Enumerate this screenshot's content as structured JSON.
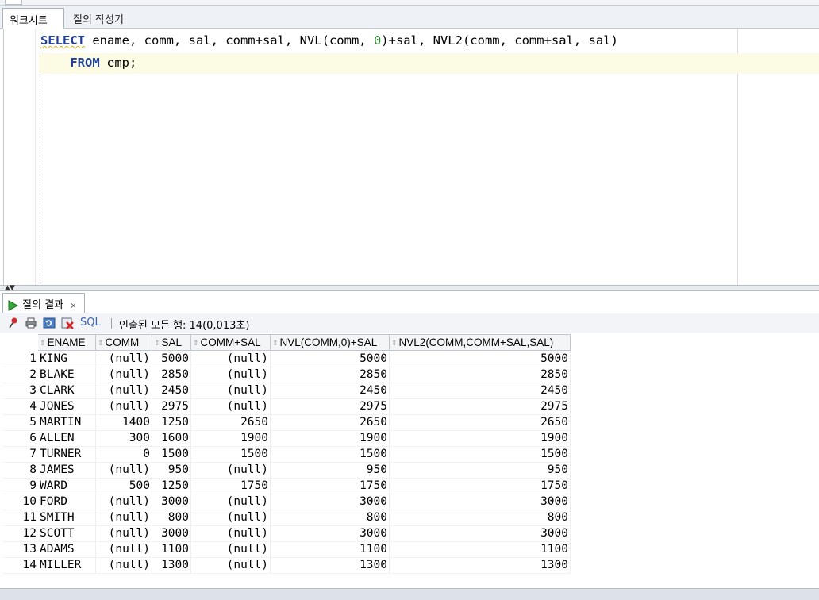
{
  "worksheet_tabs": [
    {
      "label": "워크시트"
    },
    {
      "label": "질의 작성기"
    }
  ],
  "editor": {
    "line1": {
      "keyword": "SELECT",
      "rest_a": " ename, comm, sal, comm+sal, NVL(comm, ",
      "number": "0",
      "rest_b": ")+sal, NVL2(comm, comm+sal, sal)"
    },
    "line2": {
      "keyword": "FROM",
      "rest": " emp;"
    }
  },
  "results": {
    "tab_label": "질의 결과",
    "close_glyph": "×",
    "toolbar": {
      "icons": [
        "pin-icon",
        "print-icon",
        "refresh-icon",
        "cancel-icon"
      ],
      "sql_label": "SQL",
      "status": "인출된 모든 행: 14(0,013초)"
    },
    "columns": [
      "ENAME",
      "COMM",
      "SAL",
      "COMM+SAL",
      "NVL(COMM,0)+SAL",
      "NVL2(COMM,COMM+SAL,SAL)"
    ],
    "rows": [
      [
        "1",
        "KING",
        "(null)",
        "5000",
        "(null)",
        "5000",
        "5000"
      ],
      [
        "2",
        "BLAKE",
        "(null)",
        "2850",
        "(null)",
        "2850",
        "2850"
      ],
      [
        "3",
        "CLARK",
        "(null)",
        "2450",
        "(null)",
        "2450",
        "2450"
      ],
      [
        "4",
        "JONES",
        "(null)",
        "2975",
        "(null)",
        "2975",
        "2975"
      ],
      [
        "5",
        "MARTIN",
        "1400",
        "1250",
        "2650",
        "2650",
        "2650"
      ],
      [
        "6",
        "ALLEN",
        "300",
        "1600",
        "1900",
        "1900",
        "1900"
      ],
      [
        "7",
        "TURNER",
        "0",
        "1500",
        "1500",
        "1500",
        "1500"
      ],
      [
        "8",
        "JAMES",
        "(null)",
        "950",
        "(null)",
        "950",
        "950"
      ],
      [
        "9",
        "WARD",
        "500",
        "1250",
        "1750",
        "1750",
        "1750"
      ],
      [
        "10",
        "FORD",
        "(null)",
        "3000",
        "(null)",
        "3000",
        "3000"
      ],
      [
        "11",
        "SMITH",
        "(null)",
        "800",
        "(null)",
        "800",
        "800"
      ],
      [
        "12",
        "SCOTT",
        "(null)",
        "3000",
        "(null)",
        "3000",
        "3000"
      ],
      [
        "13",
        "ADAMS",
        "(null)",
        "1100",
        "(null)",
        "1100",
        "1100"
      ],
      [
        "14",
        "MILLER",
        "(null)",
        "1300",
        "(null)",
        "1300",
        "1300"
      ]
    ]
  }
}
